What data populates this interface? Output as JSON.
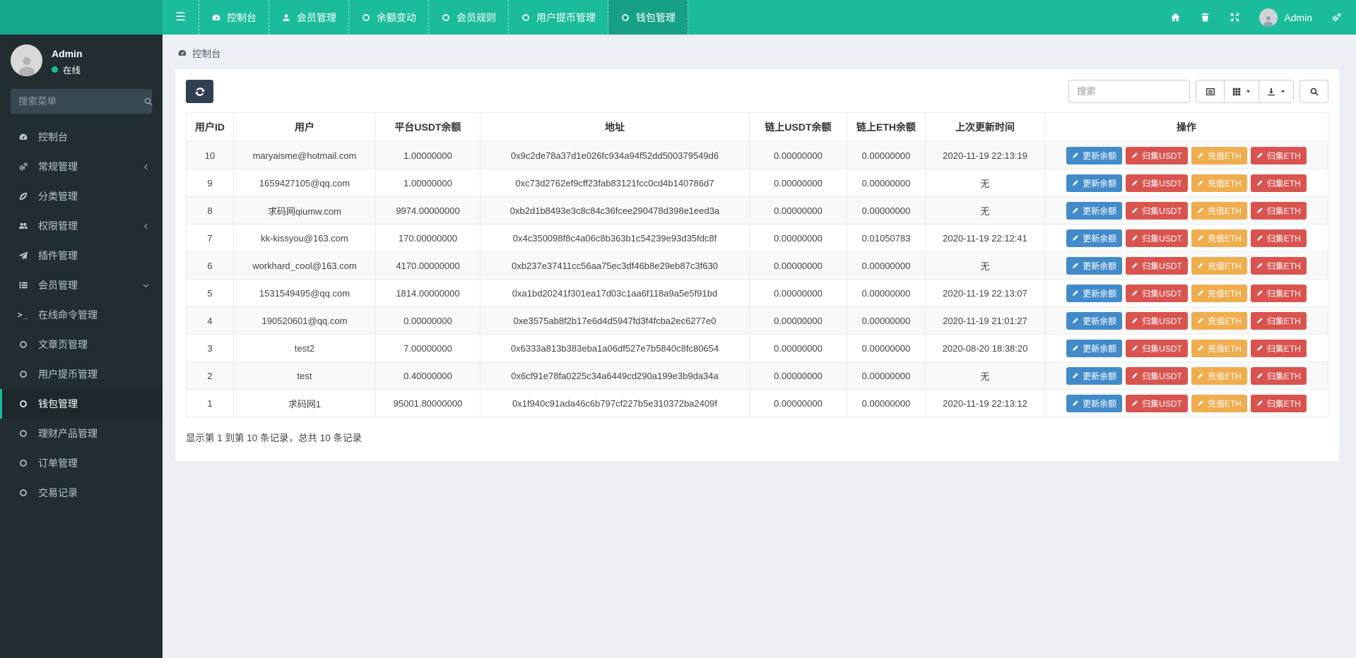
{
  "navbar": {
    "items": [
      {
        "label": "控制台",
        "icon": "dashboard-icon",
        "active": false
      },
      {
        "label": "会员管理",
        "icon": "user-icon",
        "active": false
      },
      {
        "label": "余额变动",
        "icon": "circle-icon",
        "active": false
      },
      {
        "label": "会员规则",
        "icon": "circle-icon",
        "active": false
      },
      {
        "label": "用户提币管理",
        "icon": "circle-icon",
        "active": false
      },
      {
        "label": "钱包管理",
        "icon": "circle-icon",
        "active": true
      }
    ],
    "user_name": "Admin"
  },
  "sidebar": {
    "profile": {
      "name": "Admin",
      "status": "在线"
    },
    "search_placeholder": "搜索菜单",
    "items": [
      {
        "label": "控制台",
        "icon": "dashboard-icon",
        "chevron": "",
        "active": false
      },
      {
        "label": "常规管理",
        "icon": "gears-icon",
        "chevron": "left",
        "active": false
      },
      {
        "label": "分类管理",
        "icon": "leaf-icon",
        "chevron": "",
        "active": false
      },
      {
        "label": "权限管理",
        "icon": "users-icon",
        "chevron": "left",
        "active": false
      },
      {
        "label": "插件管理",
        "icon": "rocket-icon",
        "chevron": "",
        "active": false
      },
      {
        "label": "会员管理",
        "icon": "list-icon",
        "chevron": "down",
        "active": false
      },
      {
        "label": "在线命令管理",
        "icon": "terminal-icon",
        "chevron": "",
        "active": false
      },
      {
        "label": "文章页管理",
        "icon": "circle-icon",
        "chevron": "",
        "active": false
      },
      {
        "label": "用户提币管理",
        "icon": "circle-icon",
        "chevron": "",
        "active": false
      },
      {
        "label": "钱包管理",
        "icon": "circle-icon",
        "chevron": "",
        "active": true
      },
      {
        "label": "理财产品管理",
        "icon": "circle-icon",
        "chevron": "",
        "active": false
      },
      {
        "label": "订单管理",
        "icon": "circle-icon",
        "chevron": "",
        "active": false
      },
      {
        "label": "交易记录",
        "icon": "circle-icon",
        "chevron": "",
        "active": false
      }
    ]
  },
  "breadcrumb": {
    "label": "控制台"
  },
  "toolbar": {
    "search_placeholder": "搜索"
  },
  "table": {
    "columns": [
      "用户ID",
      "用户",
      "平台USDT余额",
      "地址",
      "链上USDT余额",
      "链上ETH余额",
      "上次更新时间",
      "操作"
    ],
    "action_buttons": [
      {
        "label": "更新余额",
        "color": "#428bca"
      },
      {
        "label": "归集USDT",
        "color": "#d9534f"
      },
      {
        "label": "充值ETH",
        "color": "#f0ad4e"
      },
      {
        "label": "归集ETH",
        "color": "#d9534f"
      }
    ],
    "rows": [
      {
        "id": "10",
        "user": "maryaisme@hotmail.com",
        "usdt_balance": "1.00000000",
        "address": "0x9c2de78a37d1e026fc934a94f52dd500379549d6",
        "chain_usdt": "0.00000000",
        "chain_eth": "0.00000000",
        "updated": "2020-11-19 22:13:19"
      },
      {
        "id": "9",
        "user": "1659427105@qq.com",
        "usdt_balance": "1.00000000",
        "address": "0xc73d2762ef9cff23fab83121fcc0cd4b140786d7",
        "chain_usdt": "0.00000000",
        "chain_eth": "0.00000000",
        "updated": "无"
      },
      {
        "id": "8",
        "user": "求码网qiumw.com",
        "usdt_balance": "9974.00000000",
        "address": "0xb2d1b8493e3c8c84c36fcee290478d398e1eed3a",
        "chain_usdt": "0.00000000",
        "chain_eth": "0.00000000",
        "updated": "无"
      },
      {
        "id": "7",
        "user": "kk-kissyou@163.com",
        "usdt_balance": "170.00000000",
        "address": "0x4c350098f8c4a06c8b363b1c54239e93d35fdc8f",
        "chain_usdt": "0.00000000",
        "chain_eth": "0.01050783",
        "updated": "2020-11-19 22:12:41"
      },
      {
        "id": "6",
        "user": "workhard_cool@163.com",
        "usdt_balance": "4170.00000000",
        "address": "0xb237e37411cc56aa75ec3df46b8e29eb87c3f630",
        "chain_usdt": "0.00000000",
        "chain_eth": "0.00000000",
        "updated": "无"
      },
      {
        "id": "5",
        "user": "1531549495@qq.com",
        "usdt_balance": "1814.00000000",
        "address": "0xa1bd20241f301ea17d03c1aa6f118a9a5e5f91bd",
        "chain_usdt": "0.00000000",
        "chain_eth": "0.00000000",
        "updated": "2020-11-19 22:13:07"
      },
      {
        "id": "4",
        "user": "190520601@qq.com",
        "usdt_balance": "0.00000000",
        "address": "0xe3575ab8f2b17e6d4d5947fd3f4fcba2ec6277e0",
        "chain_usdt": "0.00000000",
        "chain_eth": "0.00000000",
        "updated": "2020-11-19 21:01:27"
      },
      {
        "id": "3",
        "user": "test2",
        "usdt_balance": "7.00000000",
        "address": "0x6333a813b383eba1a06df527e7b5840c8fc80654",
        "chain_usdt": "0.00000000",
        "chain_eth": "0.00000000",
        "updated": "2020-08-20 18:38:20"
      },
      {
        "id": "2",
        "user": "test",
        "usdt_balance": "0.40000000",
        "address": "0x6cf91e78fa0225c34a6449cd290a199e3b9da34a",
        "chain_usdt": "0.00000000",
        "chain_eth": "0.00000000",
        "updated": "无"
      },
      {
        "id": "1",
        "user": "求码网1",
        "usdt_balance": "95001.80000000",
        "address": "0x1f940c91ada46c6b797cf227b5e310372ba2409f",
        "chain_usdt": "0.00000000",
        "chain_eth": "0.00000000",
        "updated": "2020-11-19 22:13:12"
      }
    ],
    "summary": "显示第 1 到第 10 条记录，总共 10 条记录"
  },
  "colors": {
    "navbar": "#1abc9c",
    "navbar_logo": "#17a78b",
    "sidebar_bg": "#222d32",
    "sidebar_active_bg": "#1e282c",
    "accent": "#1abc9c",
    "content_bg": "#ecf0f5",
    "refresh_button": "#2f4050",
    "primary_button": "#428bca",
    "danger_button": "#d9534f",
    "warning_button": "#f0ad4e",
    "online_dot": "#1abc9c"
  }
}
